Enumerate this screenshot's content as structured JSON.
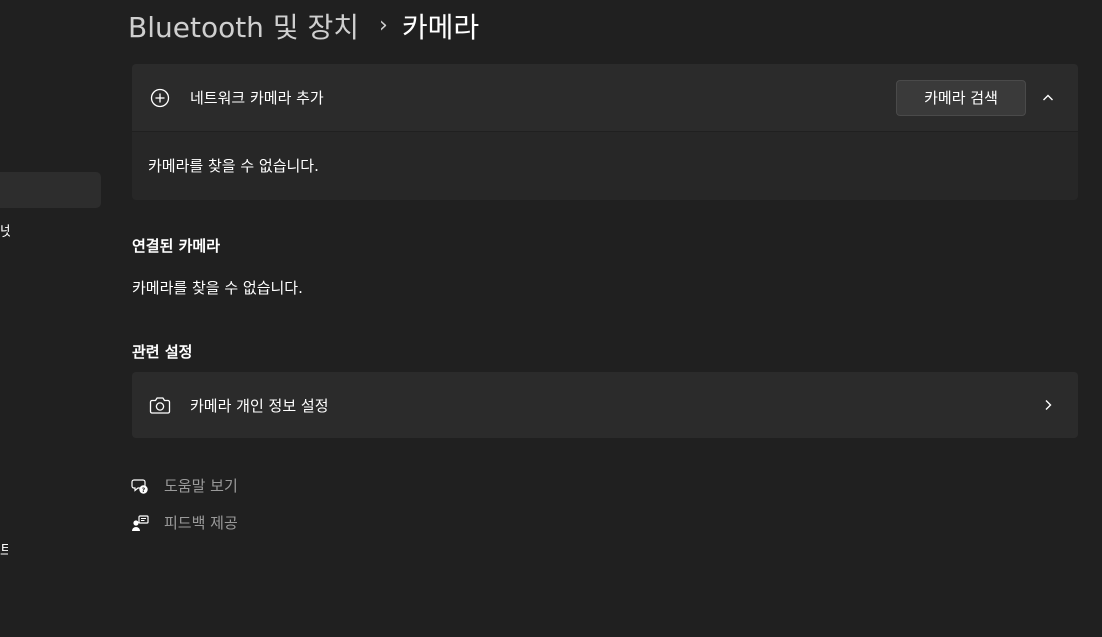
{
  "sidebar": {
    "fragments": [
      {
        "text": "넷"
      },
      {
        "text": "트"
      }
    ]
  },
  "breadcrumb": {
    "parent": "Bluetooth 및 장치",
    "separator": "›",
    "current": "카메라"
  },
  "network_camera": {
    "label": "네트워크 카메라 추가",
    "search_button": "카메라 검색",
    "icon": "add-circle-icon",
    "expand_icon": "chevron-up-icon",
    "empty_message": "카메라를 찾을 수 없습니다."
  },
  "connected_cameras": {
    "title": "연결된 카메라",
    "empty_message": "카메라를 찾을 수 없습니다."
  },
  "related_settings": {
    "title": "관련 설정",
    "privacy": {
      "label": "카메라 개인 정보 설정",
      "icon": "camera-icon"
    }
  },
  "help_links": [
    {
      "label": "도움말 보기",
      "icon": "help-chat-icon"
    },
    {
      "label": "피드백 제공",
      "icon": "feedback-icon"
    }
  ],
  "colors": {
    "background": "#202020",
    "card": "#2b2b2b",
    "muted_text": "#9a9a9a"
  }
}
